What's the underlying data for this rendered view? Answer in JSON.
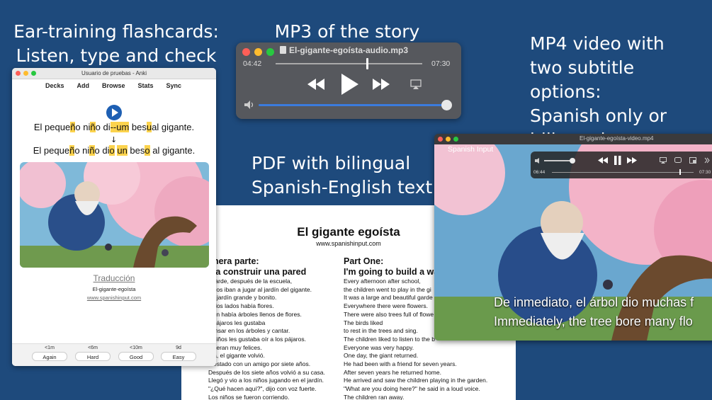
{
  "captions": {
    "anki_line1": "Ear-training flashcards:",
    "anki_line2": "Listen, type and check",
    "mp3": "MP3 of the story",
    "mp4_line1": "MP4 video with",
    "mp4_line2": "two subtitle options:",
    "mp4_line3": "Spanish only or",
    "mp4_line4": "bilingual",
    "pdf_line1": "PDF with bilingual",
    "pdf_line2": "Spanish-English text"
  },
  "anki": {
    "window_title": "Usuario de pruebas - Anki",
    "menu": [
      "Decks",
      "Add",
      "Browse",
      "Stats",
      "Sync"
    ],
    "typed": [
      "El peque",
      "ñ",
      "o ni",
      "ñ",
      "o di",
      "--um",
      " bes",
      "u",
      "al gigante."
    ],
    "correct": [
      "El peque",
      "ñ",
      "o ni",
      "ñ",
      "o di",
      "o",
      " ",
      "un",
      " bes",
      "o",
      " al gigante."
    ],
    "arrow": "↓",
    "translation_link": "Traducción",
    "deck_name": "El-gigante-egoísta",
    "url": "www.spanishinput.com",
    "buttons": [
      {
        "time": "<1m",
        "label": "Again"
      },
      {
        "time": "<6m",
        "label": "Hard"
      },
      {
        "time": "<10m",
        "label": "Good"
      },
      {
        "time": "9d",
        "label": "Easy"
      }
    ]
  },
  "mp3": {
    "title": "El-gigante-egoísta-audio.mp3",
    "elapsed": "04:42",
    "total": "07:30",
    "progress": 0.62,
    "volume": 0.97
  },
  "mp4": {
    "title": "El-gigante-egoísta-video.mp4",
    "label": "Spanish Input",
    "elapsed": "06:44",
    "total": "07:30",
    "progress": 0.9,
    "subtitle_es": "De inmediato, el árbol dio muchas f",
    "subtitle_en": "Immediately, the tree bore many flo"
  },
  "pdf": {
    "title": "El gigante egoísta",
    "url": "www.spanishinput.com",
    "left_heading1": "imera parte:",
    "left_heading2": "y a construir una pared",
    "left_lines": [
      "a tarde, después de la escuela,",
      "niños iban a jugar al jardín del gigante.",
      "un jardín grande y bonito.",
      "todos lados había flores.",
      "bién había árboles llenos de flores.",
      "s pájaros les gustaba",
      "cansar en los árboles y cantar.",
      "s niños les gustaba oír a los pájaros.",
      "os eran muy felices.",
      "día, el gigante volvió.",
      "a estado con un amigo por siete años.",
      "Después de los siete años volvió a su casa.",
      "Llegó y vio a los niños jugando en el jardín.",
      "\"¿Qué hacen aquí?\", dijo con voz fuerte.",
      "Los niños se fueron corriendo."
    ],
    "right_heading1": "Part One:",
    "right_heading2": "I'm going to build a wa",
    "right_lines": [
      "Every afternoon after school,",
      "the children went to play in the gi",
      "It was a large and beautiful garde",
      "Everywhere there were flowers.",
      "There were also trees full of flowe",
      "The birds liked",
      "to rest in the trees and sing.",
      "The children liked to listen to the b",
      "Everyone was very happy.",
      "One day, the giant returned.",
      "He had been with a friend for seven years.",
      "After seven years he returned home.",
      "He arrived and saw the children playing in the garden.",
      "\"What are you doing here?\" he said in a loud voice.",
      "The children ran away."
    ]
  }
}
